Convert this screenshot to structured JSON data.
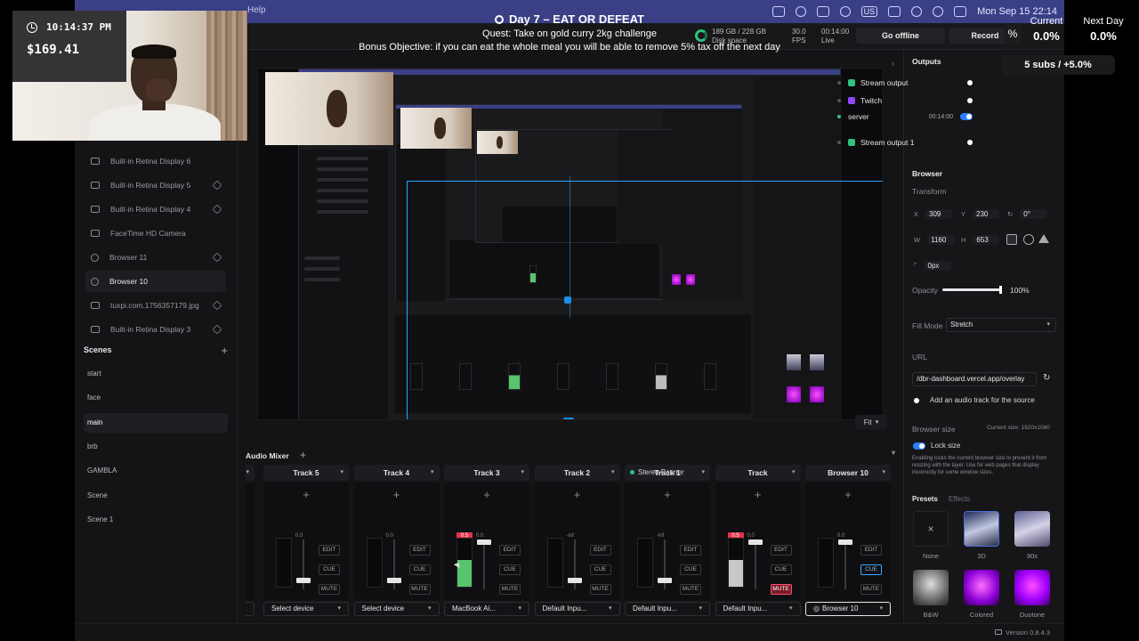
{
  "menubar": {
    "left_text": "Help",
    "datetime": "Mon Sep 15  22:14"
  },
  "overlay": {
    "clock": "10:14:37 PM",
    "money": "$169.41",
    "quest_title": "Day 7 – EAT OR DEFEAT",
    "quest_line": "Quest: Take on gold curry 2kg challenge",
    "bonus_line": "Bonus Objective: if you can eat the whole meal you will be able to remove 5% tax off the next day",
    "percent_symbol": "%",
    "current_label": "Current",
    "current_value": "0.0%",
    "nextday_label": "Next Day",
    "nextday_value": "0.0%",
    "subs": "5 subs / +5.0%"
  },
  "toolbar": {
    "disk_line1": "189 GB / 228 GB",
    "disk_line2": "Disk space",
    "fps_value": "30.0",
    "fps_label": "FPS",
    "live_time": "00:14:00",
    "live_label": "Live",
    "go_offline": "Go offline",
    "record": "Record"
  },
  "sources": [
    {
      "label": "Built-in Retina Display 6",
      "icon": "monitor-icon",
      "active": true
    },
    {
      "label": "Built-in Retina Display 5",
      "icon": "monitor-icon",
      "active": false
    },
    {
      "label": "Built-in Retina Display 4",
      "icon": "monitor-icon",
      "active": false
    },
    {
      "label": "FaceTime HD Camera",
      "icon": "camera-icon",
      "active": false
    },
    {
      "label": "Browser 11",
      "icon": "globe-icon",
      "active": false
    },
    {
      "label": "Browser 10",
      "icon": "globe-icon",
      "active": true
    },
    {
      "label": "tuxpi.com.1756357179.jpg",
      "icon": "image-icon",
      "active": false
    },
    {
      "label": "Built-in Retina Display 3",
      "icon": "monitor-icon",
      "active": false
    }
  ],
  "scenes": {
    "title": "Scenes",
    "items": [
      "start",
      "face",
      "main",
      "brb",
      "GAMBLA",
      "Scene",
      "Scene 1"
    ],
    "active_index": 2
  },
  "preview": {
    "fit_label": "Fit"
  },
  "mixer": {
    "title": "Audio Mixer",
    "tracks": [
      {
        "name": "Track 5",
        "device": "Select device",
        "clip": "",
        "db": "0.0",
        "level": 0.0,
        "fader": 0.86,
        "cue_on": false,
        "mute_on": false,
        "meter_color": "#2a2a2e"
      },
      {
        "name": "Track 4",
        "device": "Select device",
        "clip": "",
        "db": "0.0",
        "level": 0.0,
        "fader": 0.86,
        "cue_on": false,
        "mute_on": false,
        "meter_color": "#2a2a2e"
      },
      {
        "name": "Track 3",
        "device": "MacBook Ai...",
        "clip": "0.5",
        "db": "0.0",
        "level": 0.55,
        "fader": 0.0,
        "cue_on": false,
        "mute_on": false,
        "meter_color": "#58c46e"
      },
      {
        "name": "Track 2",
        "device": "Default Inpu...",
        "clip": "",
        "db": "-inf",
        "level": 0.0,
        "fader": 0.86,
        "cue_on": false,
        "mute_on": false,
        "meter_color": "#2a2a2e"
      },
      {
        "name": "Track 1",
        "device": "Default Inpu...",
        "clip": "",
        "db": "-inf",
        "level": 0.0,
        "fader": 0.86,
        "cue_on": false,
        "mute_on": false,
        "meter_color": "#2a2a2e",
        "panner": "Stereo Panner"
      },
      {
        "name": "Track",
        "device": "Default Inpu...",
        "clip": "0.5",
        "db": "0.0",
        "level": 0.55,
        "fader": 0.0,
        "cue_on": false,
        "mute_on": true,
        "meter_color": "#c8c8c8"
      },
      {
        "name": "Browser 10",
        "device": "Browser 10",
        "clip": "",
        "db": "0.0",
        "level": 0.0,
        "fader": 0.0,
        "cue_on": true,
        "mute_on": false,
        "meter_color": "#2a2a2e",
        "active": true
      }
    ],
    "labels": {
      "edit": "EDIT",
      "cue": "CUE",
      "mute": "MUTE"
    }
  },
  "right_panel": {
    "outputs_title": "Outputs",
    "outputs": [
      {
        "label": "Stream output",
        "color": "#2ec27e",
        "type": "dot"
      },
      {
        "label": "Twitch",
        "color": "#9146ff",
        "type": "dot"
      },
      {
        "label": "server",
        "color": "#2ec27e",
        "type": "toggle",
        "time": "00:14:00"
      },
      {
        "label": "Stream output 1",
        "color": "#2ec27e",
        "type": "dot"
      }
    ],
    "browser_title": "Browser",
    "transform_label": "Transform",
    "x": "309",
    "y": "230",
    "rotation": "0°",
    "w": "1160",
    "h": "653",
    "radius": "0px",
    "opacity_label": "Opacity",
    "opacity_value": "100%",
    "opacity": 1.0,
    "fill_mode_label": "Fill Mode",
    "fill_mode": "Stretch",
    "url_label": "URL",
    "url": "/dbr-dashboard.vercel.app/overlay",
    "audio_track_label": "Add an audio track for the source",
    "browser_size_label": "Browser size",
    "current_size": "Current size: 1920x1080",
    "lock_size_label": "Lock size",
    "lock_size_note": "Enabling locks the current browser size to prevent it from resizing with the layer. Use for web pages that display incorrectly for some window sizes.",
    "presets_tab": "Presets",
    "effects_tab": "Effects",
    "presets": [
      "None",
      "3D",
      "90s",
      "B&W",
      "Colored",
      "Duotone"
    ],
    "version": "Version 0.8.4.3"
  },
  "colors": {
    "accent": "#2a7fff",
    "selection": "#2aa5ff",
    "live_green": "#2ec27e",
    "mute_red": "#ff4d6d",
    "menubar": "#3a3f86"
  }
}
